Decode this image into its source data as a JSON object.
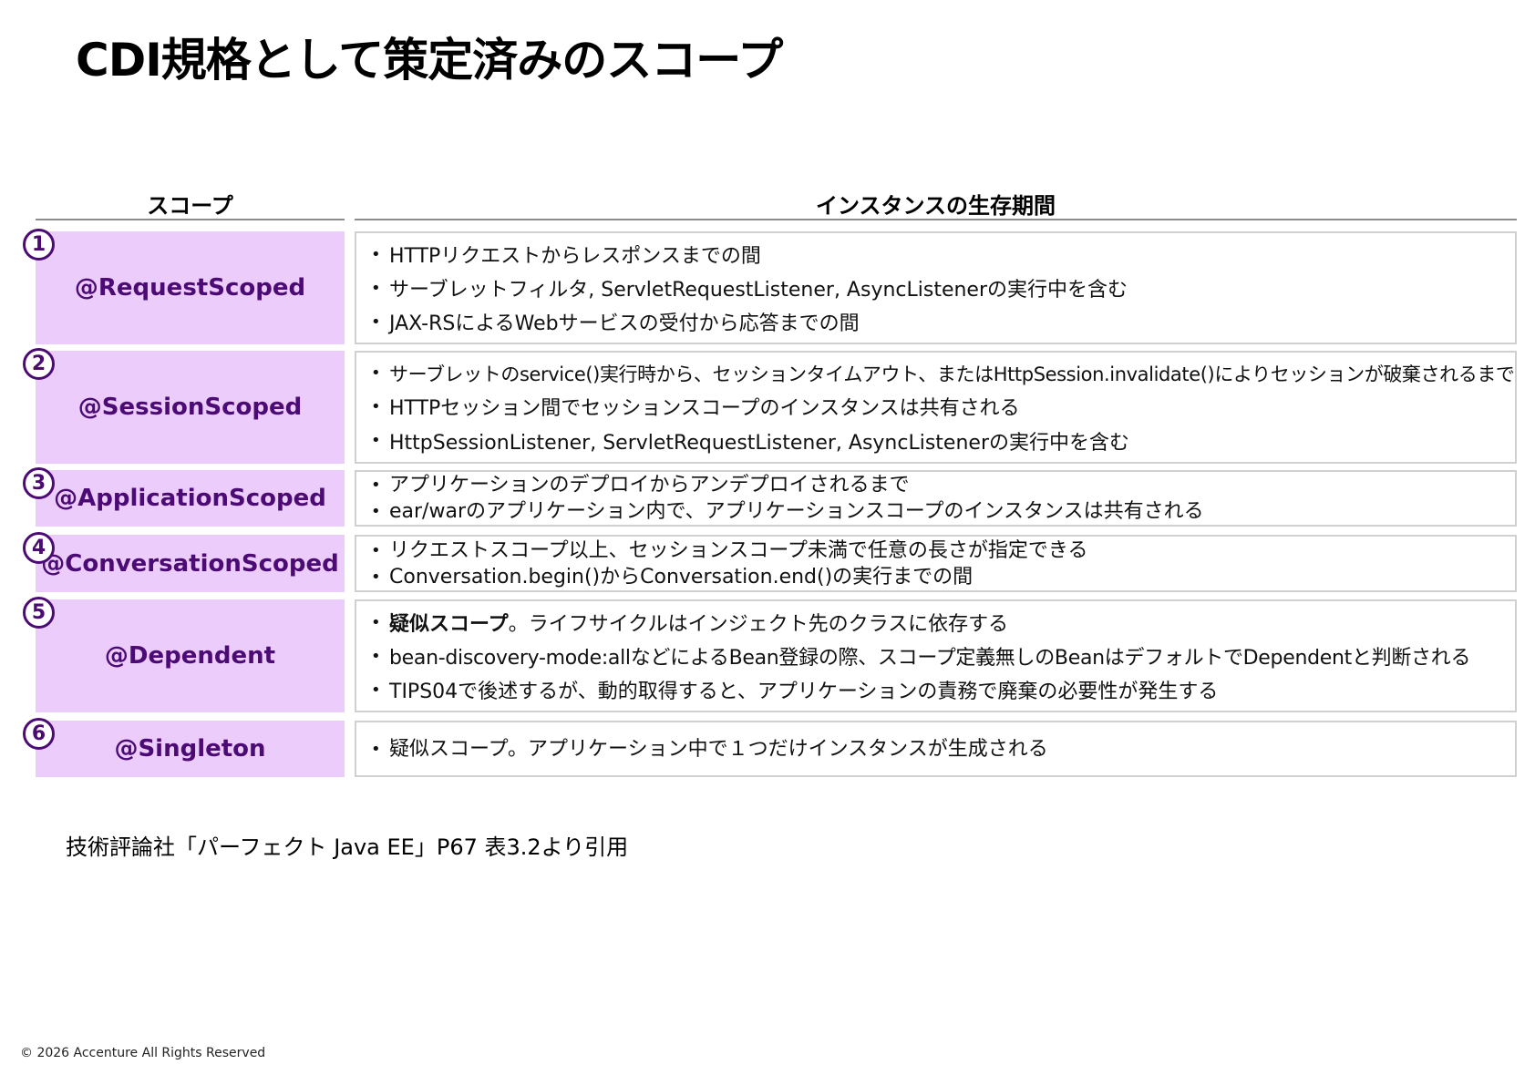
{
  "title": "CDI規格として策定済みのスコープ",
  "headers": {
    "scope": "スコープ",
    "lifetime": "インスタンスの生存期間"
  },
  "bullet_symbol": "•",
  "rows": [
    {
      "number": "1",
      "scope": "@RequestScoped",
      "items": [
        {
          "text": "HTTPリクエストからレスポンスまでの間"
        },
        {
          "text": "サーブレットフィルタ, ServletRequestListener, AsyncListenerの実行中を含む"
        },
        {
          "text": "JAX-RSによるWebサービスの受付から応答までの間"
        }
      ]
    },
    {
      "number": "2",
      "scope": "@SessionScoped",
      "items": [
        {
          "text": "サーブレットのservice()実行時から、セッションタイムアウト、またはHttpSession.invalidate()によりセッションが破棄されるまで"
        },
        {
          "text": "HTTPセッション間でセッションスコープのインスタンスは共有される"
        },
        {
          "text": "HttpSessionListener, ServletRequestListener, AsyncListenerの実行中を含む"
        }
      ]
    },
    {
      "number": "3",
      "scope": "@ApplicationScoped",
      "items": [
        {
          "text": "アプリケーションのデプロイからアンデプロイされるまで"
        },
        {
          "text": "ear/warのアプリケーション内で、アプリケーションスコープのインスタンスは共有される"
        }
      ]
    },
    {
      "number": "4",
      "scope": "@ConversationScoped",
      "items": [
        {
          "text": "リクエストスコープ以上、セッションスコープ未満で任意の長さが指定できる"
        },
        {
          "text": "Conversation.begin()からConversation.end()の実行までの間"
        }
      ]
    },
    {
      "number": "5",
      "scope": "@Dependent",
      "items": [
        {
          "strong": "疑似スコープ",
          "text": "。ライフサイクルはインジェクト先のクラスに依存する"
        },
        {
          "text": "bean-discovery-mode:allなどによるBean登録の際、スコープ定義無しのBeanはデフォルトでDependentと判断される"
        },
        {
          "text": "TIPS04で後述するが、動的取得すると、アプリケーションの責務で廃棄の必要性が発生する"
        }
      ]
    },
    {
      "number": "6",
      "scope": "@Singleton",
      "items": [
        {
          "text": "疑似スコープ。アプリケーション中で１つだけインスタンスが生成される"
        }
      ]
    }
  ],
  "source": "技術評論社「パーフェクト Java EE」P67 表3.2より引用",
  "copyright": "© 2026 Accenture All Rights Reserved",
  "colors": {
    "scope_bg": "#ebccfb",
    "scope_text": "#4c0b74",
    "border": "#d0d0d0"
  }
}
